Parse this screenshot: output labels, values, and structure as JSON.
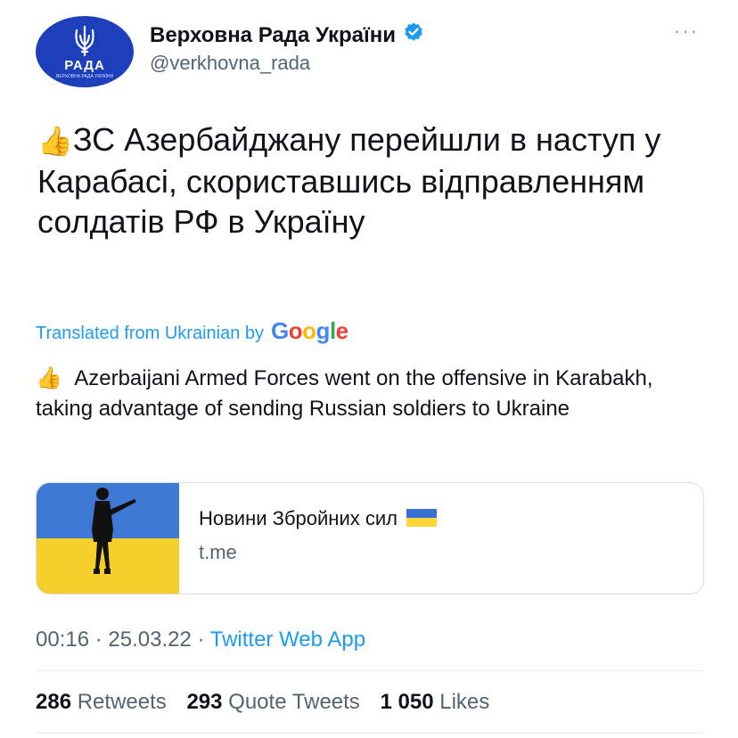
{
  "account": {
    "display_name": "Верховна Рада України",
    "handle": "@verkhovna_rada",
    "avatar_label": "РАДА",
    "avatar_small": "ВЕРХОВНА РАДА УКРАЇНИ",
    "verified_icon": "verified-badge-icon",
    "more_label": "···"
  },
  "tweet": {
    "emoji": "👍",
    "text": "ЗС Азербайджану перейшли в наступ у Карабасі, скориставшись відправленням солдатів РФ в Україну",
    "translated_prefix": "Translated from Ukrainian by",
    "google_letters": [
      "G",
      "o",
      "o",
      "g",
      "l",
      "e"
    ],
    "translation_emoji": "👍",
    "translation": "Azerbaijani Armed Forces went on the offensive in Karabakh, taking advantage of sending Russian soldiers to Ukraine"
  },
  "card": {
    "title": "Новини Збройних сил",
    "domain": "t.me"
  },
  "meta": {
    "time": "00:16",
    "sep1": "·",
    "date": "25.03.22",
    "sep2": "·",
    "app": "Twitter Web App"
  },
  "stats": {
    "retweets_count": "286",
    "retweets_label": "Retweets",
    "quotes_count": "293",
    "quotes_label": "Quote Tweets",
    "likes_count": "1 050",
    "likes_label": "Likes"
  },
  "colors": {
    "accent": "#1d9bf0",
    "avatar_bg": "#1d3fbb",
    "flag_blue": "#3a6fd8",
    "flag_yellow": "#ffd43b"
  }
}
